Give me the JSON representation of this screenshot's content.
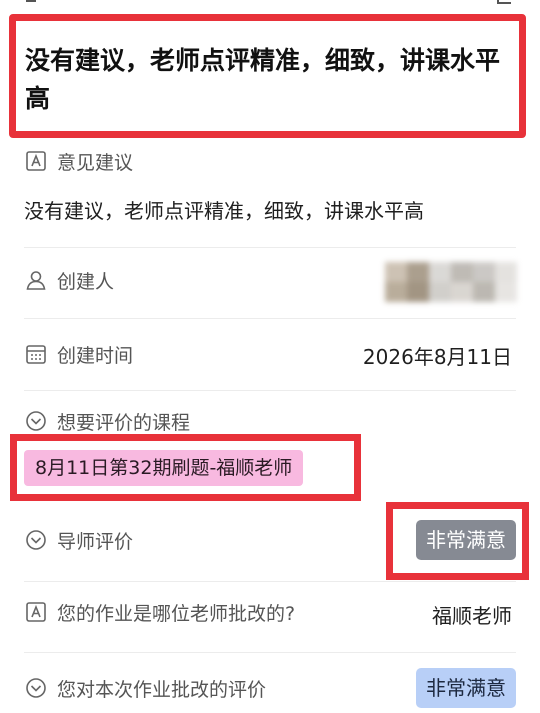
{
  "title": "没有建议，老师点评精准，细致，讲课水平高",
  "fields": {
    "suggestion": {
      "icon": "text-box-icon",
      "label": "意见建议",
      "value": "没有建议，老师点评精准，细致，讲课水平高"
    },
    "creator": {
      "icon": "person-icon",
      "label": "创建人"
    },
    "created_time": {
      "icon": "calendar-icon",
      "label": "创建时间",
      "value": "2026年8月11日"
    },
    "course": {
      "icon": "dropdown-circle-icon",
      "label": "想要评价的课程",
      "value": "8月11日第32期刷题-福顺老师"
    },
    "tutor_rating": {
      "icon": "dropdown-circle-icon",
      "label": "导师评价",
      "value": "非常满意"
    },
    "grader": {
      "icon": "text-box-icon",
      "label": "您的作业是哪位老师批改的?",
      "value": "福顺老师"
    },
    "grading_rating": {
      "icon": "dropdown-circle-icon",
      "label": "您对本次作业批改的评价",
      "value": "非常满意"
    }
  },
  "colors": {
    "highlight_border": "#e8323a",
    "course_tag_bg": "#f8b9e0",
    "tutor_tag_bg": "#868a93",
    "grading_tag_bg": "#b8cff7"
  }
}
